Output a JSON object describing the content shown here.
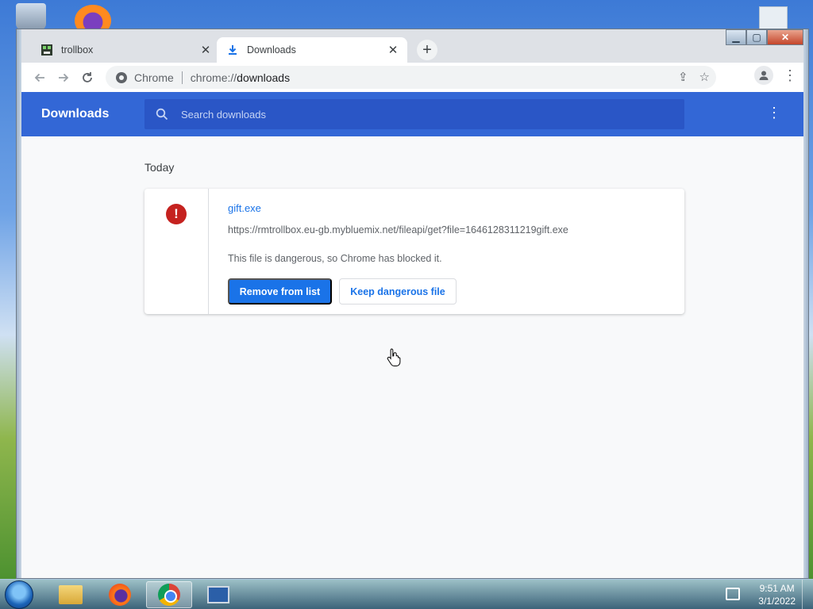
{
  "browser": {
    "tabs": [
      {
        "title": "trollbox",
        "active": false,
        "icon": "trollbox-favicon"
      },
      {
        "title": "Downloads",
        "active": true,
        "icon": "download-icon"
      }
    ],
    "new_tab_label": "+",
    "omnibox": {
      "chip": "Chrome",
      "url_scheme": "chrome://",
      "url_host": "downloads"
    }
  },
  "downloads": {
    "title": "Downloads",
    "search_placeholder": "Search downloads",
    "section_date": "Today",
    "item": {
      "filename": "gift.exe",
      "url": "https://rmtrollbox.eu-gb.mybluemix.net/fileapi/get?file=1646128311219gift.exe",
      "warning": "This file is dangerous, so Chrome has blocked it.",
      "remove_label": "Remove from list",
      "keep_label": "Keep dangerous file",
      "status_icon": "danger-icon"
    }
  },
  "taskbar": {
    "time": "9:51 AM",
    "date": "3/1/2022"
  },
  "colors": {
    "header_blue": "#3367d6",
    "accent_blue": "#1a73e8",
    "danger_red": "#c5221f"
  }
}
